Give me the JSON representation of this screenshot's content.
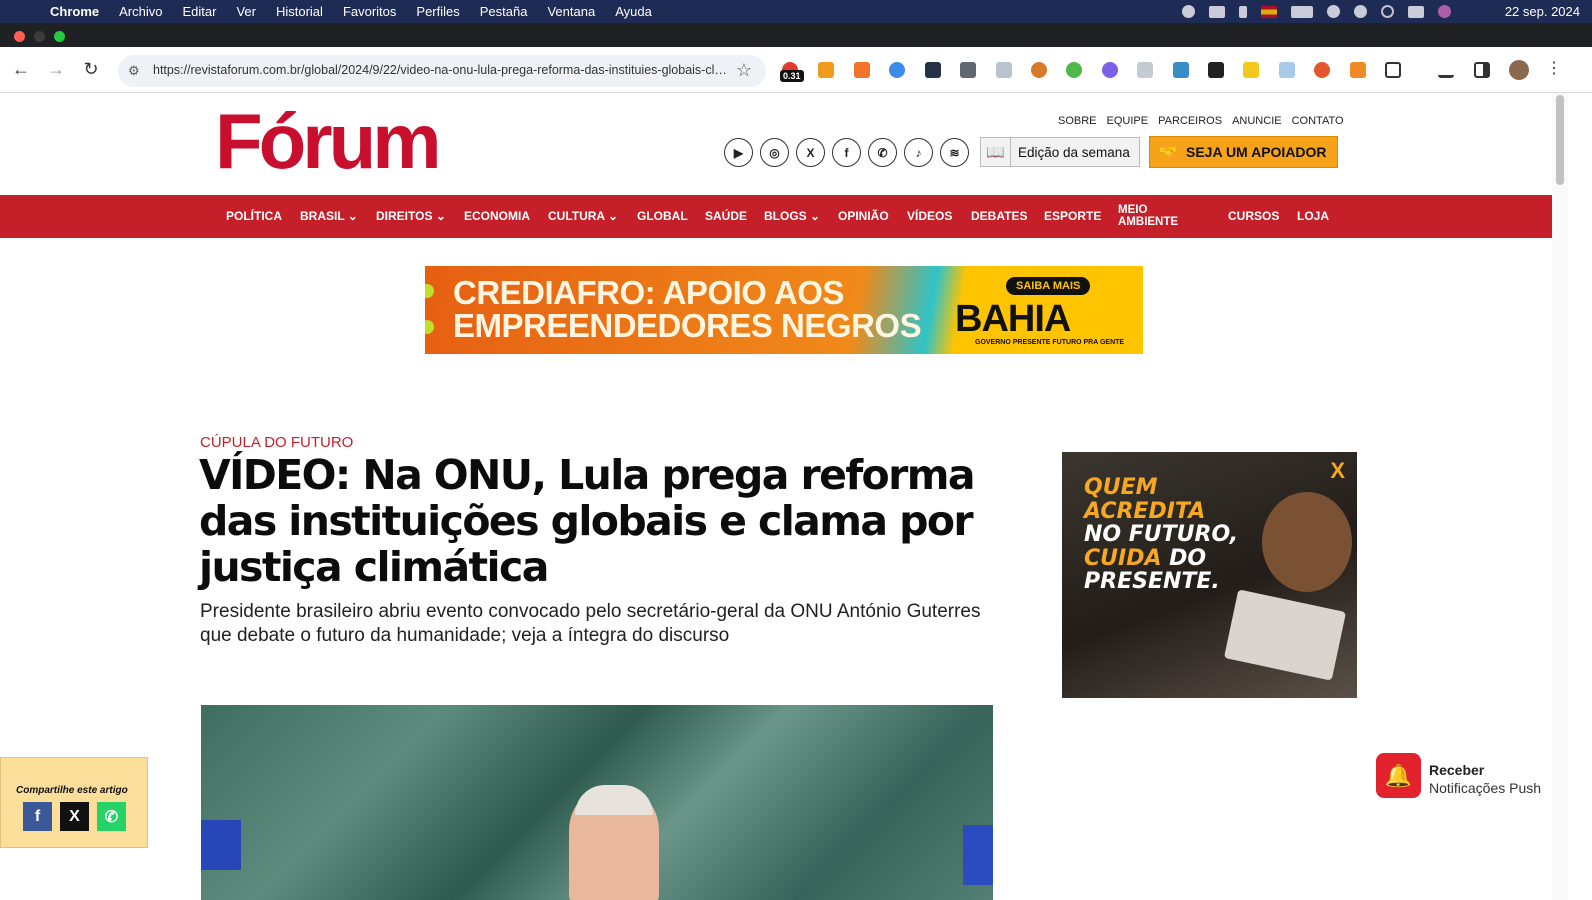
{
  "menubar": {
    "app": "Chrome",
    "items": [
      "Archivo",
      "Editar",
      "Ver",
      "Historial",
      "Favoritos",
      "Perfiles",
      "Pestaña",
      "Ventana",
      "Ayuda"
    ],
    "date": "22 sep. 2024"
  },
  "browser": {
    "url": "https://revistaforum.com.br/global/2024/9/22/video-na-onu-lula-prega-reforma-das-instituies-globais-cl ...",
    "extension_badge": "0.31"
  },
  "site": {
    "logo": "Fórum",
    "top_links": [
      "SOBRE",
      "EQUIPE",
      "PARCEIROS",
      "ANUNCIE",
      "CONTATO"
    ],
    "socials": [
      "youtube-icon",
      "instagram-icon",
      "x-icon",
      "facebook-icon",
      "whatsapp-icon",
      "tiktok-icon",
      "spotify-icon"
    ],
    "edition_label": "Edição da semana",
    "supporter_label": "SEJA UM APOIADOR",
    "nav": [
      "POLÍTICA",
      "BRASIL",
      "DIREITOS",
      "ECONOMIA",
      "CULTURA",
      "GLOBAL",
      "SAÚDE",
      "BLOGS",
      "OPINIÃO",
      "VÍDEOS",
      "DEBATES",
      "ESPORTE",
      "MEIO AMBIENTE",
      "CURSOS",
      "LOJA"
    ],
    "nav_dropdowns": [
      "BRASIL",
      "DIREITOS",
      "CULTURA",
      "BLOGS"
    ]
  },
  "banner_ad": {
    "line1": "CREDIAFRO: APOIO AOS",
    "line2": "EMPREENDEDORES NEGROS",
    "cta": "SAIBA MAIS",
    "brand": "BAHIA",
    "tagline": "GOVERNO PRESENTE FUTURO PRA GENTE"
  },
  "article": {
    "kicker": "CÚPULA DO FUTURO",
    "headline": "VÍDEO: Na ONU, Lula prega reforma das instituições globais e clama por justiça climática",
    "subtitle": "Presidente brasileiro abriu evento convocado pelo secretário-geral da ONU António Guterres que debate o futuro da humanidade; veja a íntegra do discurso"
  },
  "side_ad": {
    "l1": "QUEM",
    "l2": "ACREDITA",
    "l3": "NO FUTURO,",
    "l4a": "CUIDA",
    "l4b": " DO",
    "l5": "PRESENTE."
  },
  "share": {
    "label": "Compartilhe este artigo",
    "fb": "f",
    "x": "X",
    "wa": "✆"
  },
  "push": {
    "title": "Receber",
    "subtitle": "Notificações Push"
  },
  "colors": {
    "brand_red": "#c51f2a",
    "supporter_orange": "#f6a21a"
  }
}
